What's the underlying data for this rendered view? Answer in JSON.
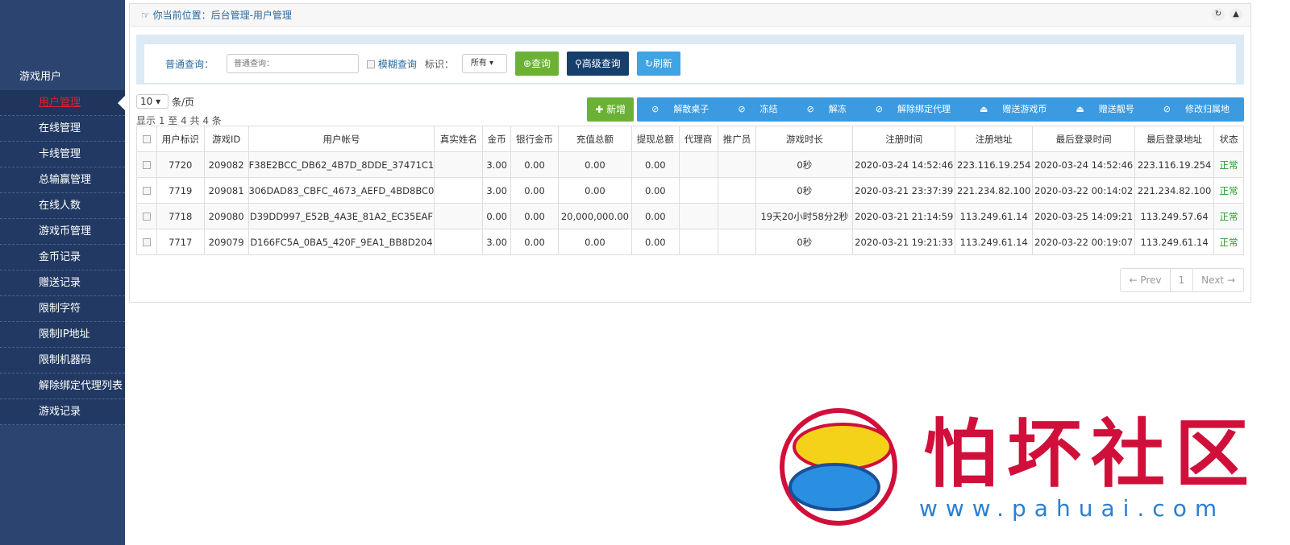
{
  "sidebar": {
    "group": "游戏用户",
    "items": [
      "用户管理",
      "在线管理",
      "卡线管理",
      "总输赢管理",
      "在线人数",
      "游戏币管理",
      "金币记录",
      "赠送记录",
      "限制字符",
      "限制IP地址",
      "限制机器码",
      "解除绑定代理列表",
      "游戏记录"
    ],
    "active": 0
  },
  "breadcrumb": "你当前位置：后台管理-用户管理",
  "search": {
    "label": "普通查询：",
    "placeholder": "普通查询：",
    "fuzzy": "模糊查询",
    "tag_label": "标识：",
    "tag_value": "所有",
    "query": "查询",
    "advanced": "高级查询",
    "refresh": "刷新"
  },
  "list": {
    "per_page": "10",
    "per_page_unit": "条/页",
    "info": "显示 1 至 4 共 4 条"
  },
  "actions": {
    "add": "新增",
    "bar": [
      "解散桌子",
      "冻结",
      "解冻",
      "解除绑定代理",
      "赠送游戏币",
      "赠送靓号",
      "修改归属地"
    ]
  },
  "table": {
    "headers": [
      "用户标识",
      "游戏ID",
      "用户帐号",
      "真实姓名",
      "金币",
      "银行金币",
      "充值总额",
      "提现总额",
      "代理商",
      "推广员",
      "游戏时长",
      "注册时间",
      "注册地址",
      "最后登录时间",
      "最后登录地址",
      "状态"
    ],
    "rows": [
      [
        "7720",
        "209082",
        "F38E2BCC_DB62_4B7D_8DDE_37471C1",
        "",
        "3.00",
        "0.00",
        "0.00",
        "0.00",
        "",
        "",
        "0秒",
        "2020-03-24 14:52:46",
        "223.116.19.254",
        "2020-03-24 14:52:46",
        "223.116.19.254",
        "正常"
      ],
      [
        "7719",
        "209081",
        "306DAD83_CBFC_4673_AEFD_4BD8BC0",
        "",
        "3.00",
        "0.00",
        "0.00",
        "0.00",
        "",
        "",
        "0秒",
        "2020-03-21 23:37:39",
        "221.234.82.100",
        "2020-03-22 00:14:02",
        "221.234.82.100",
        "正常"
      ],
      [
        "7718",
        "209080",
        "D39DD997_E52B_4A3E_81A2_EC35EAF",
        "",
        "0.00",
        "0.00",
        "20,000,000.00",
        "0.00",
        "",
        "",
        "19天20小时58分2秒",
        "2020-03-21 21:14:59",
        "113.249.61.14",
        "2020-03-25 14:09:21",
        "113.249.57.64",
        "正常"
      ],
      [
        "7717",
        "209079",
        "D166FC5A_0BA5_420F_9EA1_BB8D204",
        "",
        "3.00",
        "0.00",
        "0.00",
        "0.00",
        "",
        "",
        "0秒",
        "2020-03-21 19:21:33",
        "113.249.61.14",
        "2020-03-22 00:19:07",
        "113.249.61.14",
        "正常"
      ]
    ]
  },
  "pager": {
    "prev": "← Prev",
    "page": "1",
    "next": "Next →"
  },
  "watermark": {
    "name": "怕坏社区",
    "url": "www.pahuai.com"
  },
  "colors": {
    "sidebar": "#2b4470",
    "active": "#e0202a",
    "status_ok": "#2a9a2a"
  }
}
